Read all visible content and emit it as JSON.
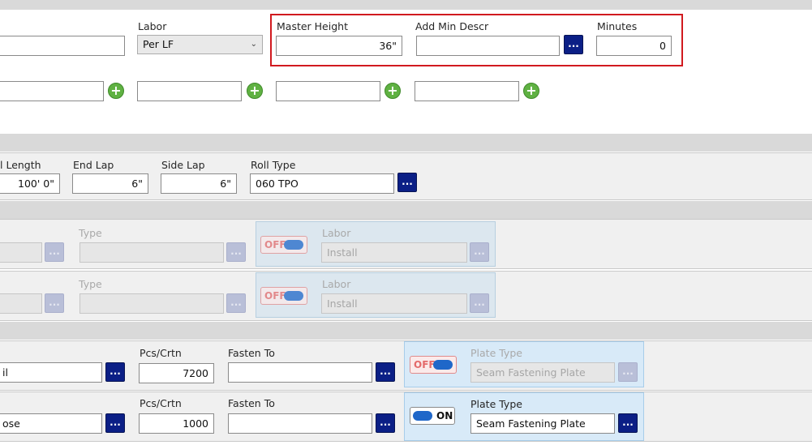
{
  "top_section": {
    "labor": {
      "label": "Labor",
      "value": "Per LF"
    },
    "master_height": {
      "label": "Master Height",
      "value": "36\""
    },
    "add_min_descr": {
      "label": "Add Min Descr",
      "value": ""
    },
    "minutes": {
      "label": "Minutes",
      "value": "0"
    },
    "button_label": "..."
  },
  "roll_section": {
    "roll_length": {
      "label": "l Length",
      "value": "100' 0\""
    },
    "end_lap": {
      "label": "End Lap",
      "value": "6\""
    },
    "side_lap": {
      "label": "Side Lap",
      "value": "6\""
    },
    "roll_type": {
      "label": "Roll Type",
      "value": "060 TPO"
    }
  },
  "disabled_rows": [
    {
      "type_label": "Type",
      "toggle": "OFF",
      "labor_label": "Labor",
      "labor_value": "Install"
    },
    {
      "type_label": "Type",
      "toggle": "OFF",
      "labor_label": "Labor",
      "labor_value": "Install"
    }
  ],
  "fastener_rows": [
    {
      "name_value": "il",
      "pcs_label": "Pcs/Crtn",
      "pcs_value": "7200",
      "fasten_label": "Fasten To",
      "fasten_value": "",
      "toggle": "OFF",
      "plate_label": "Plate Type",
      "plate_value": "Seam Fastening Plate"
    },
    {
      "name_value": "ose",
      "pcs_label": "Pcs/Crtn",
      "pcs_value": "1000",
      "fasten_label": "Fasten To",
      "fasten_value": "",
      "toggle": "ON",
      "plate_label": "Plate Type",
      "plate_value": "Seam Fastening Plate"
    }
  ],
  "colors": {
    "accent_button": "#0b1f86",
    "highlight_border": "#d11a1f",
    "toggle_blue": "#1f67c9",
    "add_green": "#5fb142"
  },
  "icons": {
    "add": "plus-circle-icon",
    "dropdown": "chevron-down-icon"
  }
}
